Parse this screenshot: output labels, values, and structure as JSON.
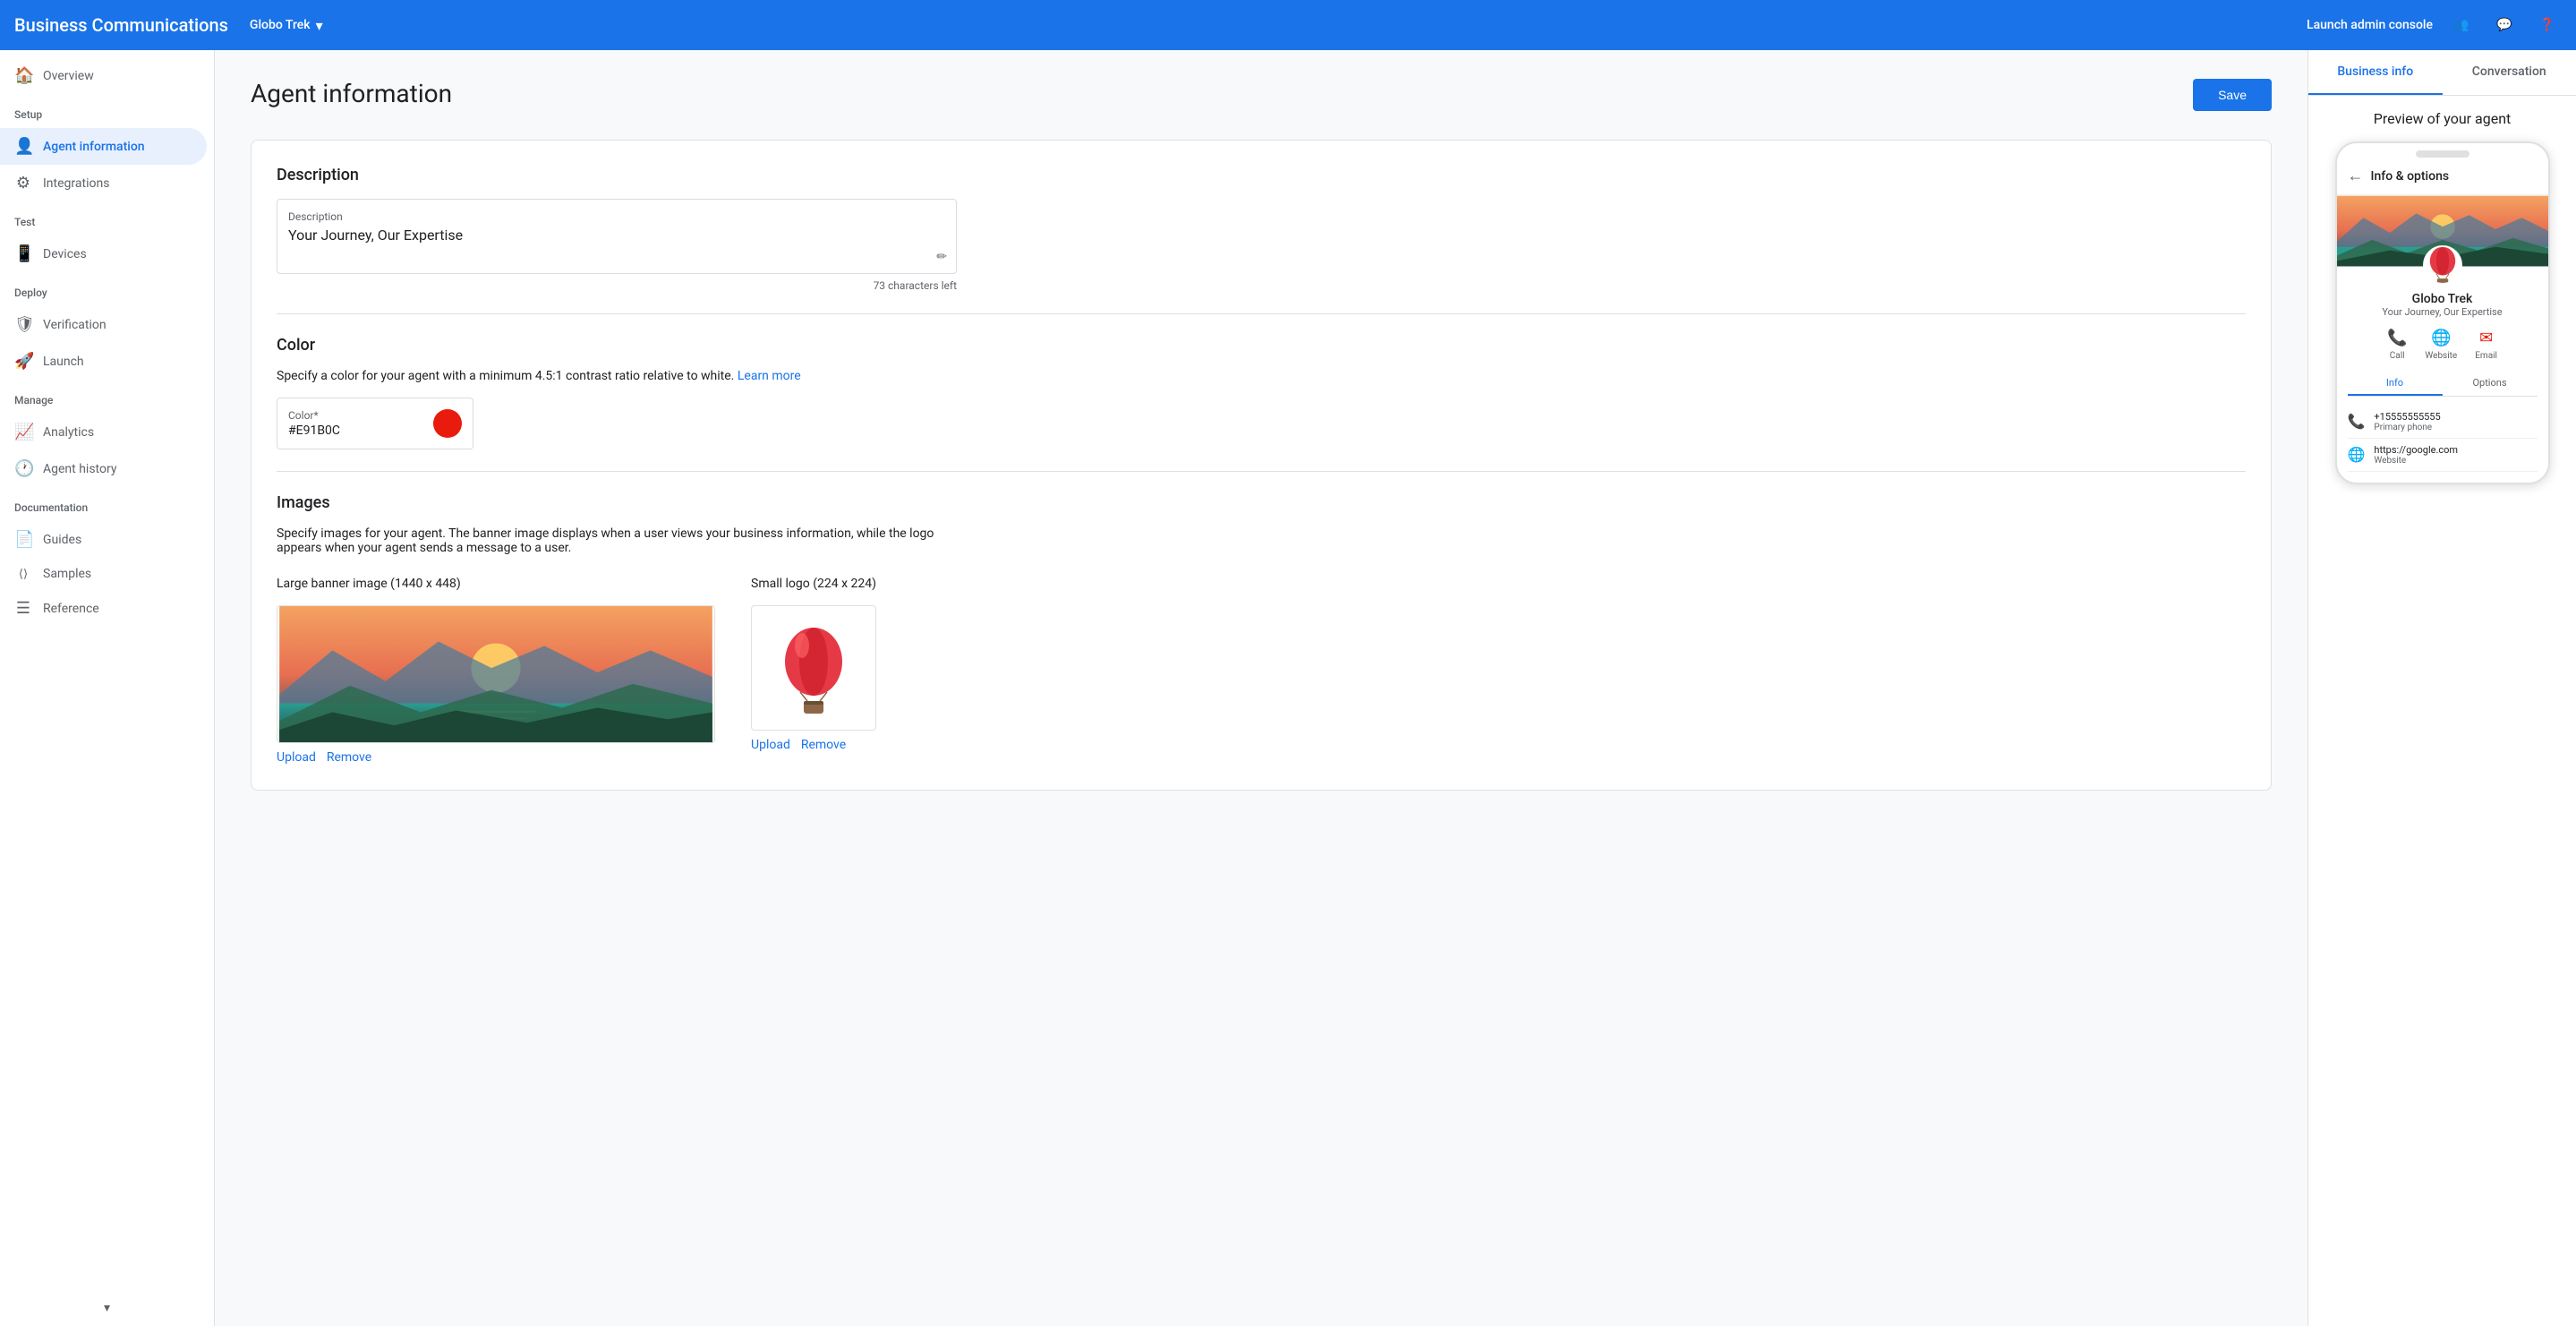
{
  "app": {
    "title": "Business Communications",
    "brand": "Globo Trek",
    "launch_admin": "Launch admin console"
  },
  "sidebar": {
    "sections": [
      {
        "label": "",
        "items": [
          {
            "id": "overview",
            "label": "Overview",
            "icon": "🏠",
            "active": false
          }
        ]
      },
      {
        "label": "Setup",
        "items": [
          {
            "id": "agent-information",
            "label": "Agent information",
            "icon": "👤",
            "active": true
          },
          {
            "id": "integrations",
            "label": "Integrations",
            "icon": "⚙",
            "active": false
          }
        ]
      },
      {
        "label": "Test",
        "items": [
          {
            "id": "devices",
            "label": "Devices",
            "icon": "📱",
            "active": false
          }
        ]
      },
      {
        "label": "Deploy",
        "items": [
          {
            "id": "verification",
            "label": "Verification",
            "icon": "🛡",
            "active": false
          },
          {
            "id": "launch",
            "label": "Launch",
            "icon": "🚀",
            "active": false
          }
        ]
      },
      {
        "label": "Manage",
        "items": [
          {
            "id": "analytics",
            "label": "Analytics",
            "icon": "📈",
            "active": false
          },
          {
            "id": "agent-history",
            "label": "Agent history",
            "icon": "🕐",
            "active": false
          }
        ]
      },
      {
        "label": "Documentation",
        "items": [
          {
            "id": "guides",
            "label": "Guides",
            "icon": "📄",
            "active": false
          },
          {
            "id": "samples",
            "label": "Samples",
            "icon": "⟨⟩",
            "active": false
          },
          {
            "id": "reference",
            "label": "Reference",
            "icon": "☰",
            "active": false
          }
        ]
      }
    ]
  },
  "page": {
    "title": "Agent information",
    "save_button": "Save"
  },
  "description_section": {
    "title": "Description",
    "field_label": "Description",
    "field_value": "Your Journey, Our Expertise",
    "characters_left": "73 characters left"
  },
  "color_section": {
    "title": "Color",
    "hint": "Specify a color for your agent with a minimum 4.5:1 contrast ratio relative to white.",
    "learn_more": "Learn more",
    "field_label": "Color*",
    "field_value": "#E91B0C",
    "dot_color": "#E91B0C"
  },
  "images_section": {
    "title": "Images",
    "hint": "Specify images for your agent. The banner image displays when a user views your business information, while the logo appears when your agent sends a message to a user.",
    "banner_label": "Large banner image (1440 x 448)",
    "logo_label": "Small logo (224 x 224)",
    "upload_label": "Upload",
    "remove_label": "Remove"
  },
  "right_panel": {
    "tabs": [
      {
        "id": "business-info",
        "label": "Business info",
        "active": true
      },
      {
        "id": "conversation",
        "label": "Conversation",
        "active": false
      }
    ],
    "preview_title": "Preview of your agent",
    "phone": {
      "header_title": "Info & options",
      "agent_name": "Globo Trek",
      "agent_desc": "Your Journey, Our Expertise",
      "actions": [
        {
          "icon": "📞",
          "label": "Call",
          "color": "#e91b0c"
        },
        {
          "icon": "🌐",
          "label": "Website",
          "color": "#e91b0c"
        },
        {
          "icon": "✉",
          "label": "Email",
          "color": "#e91b0c"
        }
      ],
      "tabs": [
        {
          "label": "Info",
          "active": true
        },
        {
          "label": "Options",
          "active": false
        }
      ],
      "info_rows": [
        {
          "icon": "📞",
          "value": "+15555555555",
          "label": "Primary phone"
        },
        {
          "icon": "🌐",
          "value": "https://google.com",
          "label": "Website"
        }
      ]
    }
  }
}
